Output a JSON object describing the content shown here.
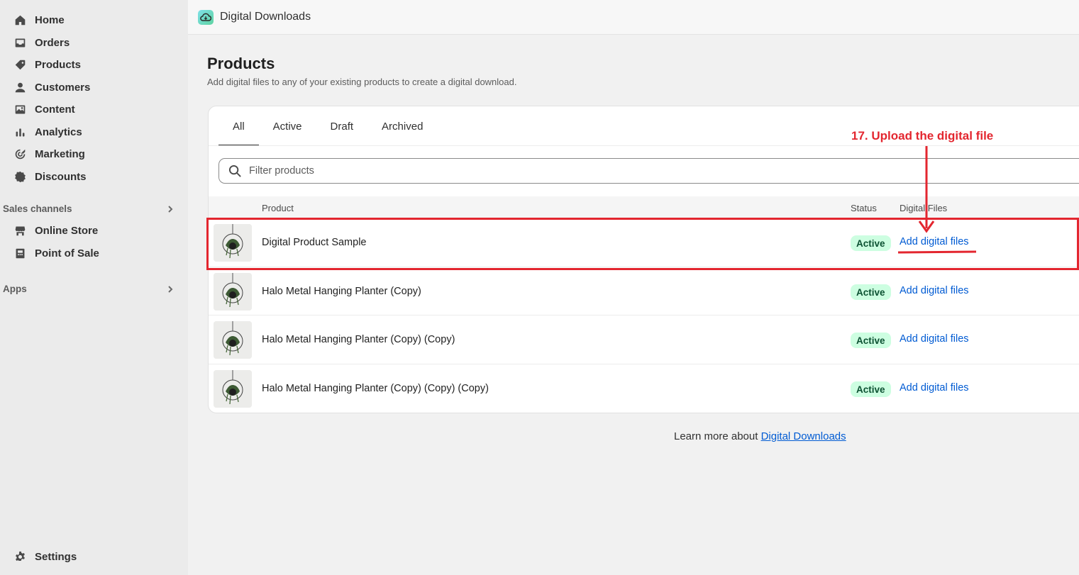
{
  "sidebar": {
    "items": [
      {
        "label": "Home",
        "icon": "home-icon"
      },
      {
        "label": "Orders",
        "icon": "inbox-icon"
      },
      {
        "label": "Products",
        "icon": "tag-icon"
      },
      {
        "label": "Customers",
        "icon": "person-icon"
      },
      {
        "label": "Content",
        "icon": "image-icon"
      },
      {
        "label": "Analytics",
        "icon": "bar-chart-icon"
      },
      {
        "label": "Marketing",
        "icon": "target-icon"
      },
      {
        "label": "Discounts",
        "icon": "discount-icon"
      }
    ],
    "sales_channels": {
      "label": "Sales channels",
      "items": [
        {
          "label": "Online Store",
          "icon": "store-icon"
        },
        {
          "label": "Point of Sale",
          "icon": "pos-icon"
        }
      ]
    },
    "apps": {
      "label": "Apps"
    },
    "settings": {
      "label": "Settings",
      "icon": "gear-icon"
    }
  },
  "topbar": {
    "app_title": "Digital Downloads",
    "app_icon": "digital-downloads-logo-icon"
  },
  "page": {
    "title": "Products",
    "subtitle": "Add digital files to any of your existing products to create a digital download."
  },
  "tabs": [
    {
      "label": "All",
      "active": true
    },
    {
      "label": "Active",
      "active": false
    },
    {
      "label": "Draft",
      "active": false
    },
    {
      "label": "Archived",
      "active": false
    }
  ],
  "search": {
    "placeholder": "Filter products"
  },
  "table": {
    "columns": {
      "product": "Product",
      "status": "Status",
      "files": "Digital Files"
    },
    "rows": [
      {
        "name": "Digital Product Sample",
        "status": "Active",
        "action": "Add digital files"
      },
      {
        "name": "Halo Metal Hanging Planter (Copy)",
        "status": "Active",
        "action": "Add digital files"
      },
      {
        "name": "Halo Metal Hanging Planter (Copy) (Copy)",
        "status": "Active",
        "action": "Add digital files"
      },
      {
        "name": "Halo Metal Hanging Planter (Copy) (Copy) (Copy)",
        "status": "Active",
        "action": "Add digital files"
      }
    ]
  },
  "footer": {
    "learn_prefix": "Learn more about ",
    "learn_link": "Digital Downloads"
  },
  "annotation": {
    "text": "17. Upload the digital file",
    "color": "#e3262f"
  },
  "colors": {
    "link": "#005bd3",
    "badge_bg": "#cdfee1",
    "badge_text": "#0c5132",
    "sidebar_bg": "#ebebeb"
  }
}
